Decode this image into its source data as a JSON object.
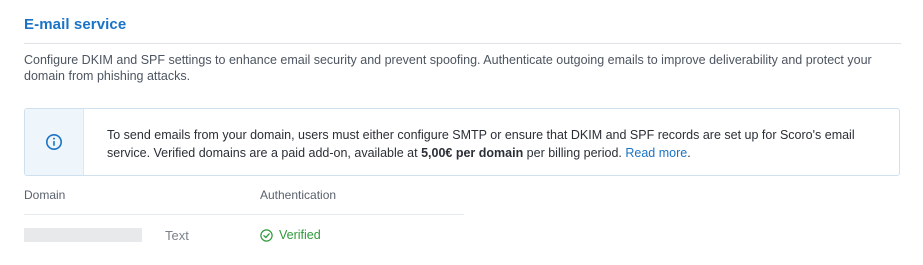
{
  "section": {
    "title": "E-mail service",
    "description": "Configure DKIM and SPF settings to enhance email security and prevent spoofing. Authenticate outgoing emails to improve deliverability and protect your domain from phishing attacks."
  },
  "info": {
    "icon": "info-icon",
    "text_before": "To send emails from your domain, users must either configure SMTP or ensure that DKIM and SPF records are set up for Scoro's email service. Verified domains are a paid add-on, available at ",
    "price": "5,00€ per domain",
    "text_after": " per billing period. ",
    "link_label": "Read more",
    "text_end": "."
  },
  "table": {
    "headers": {
      "domain": "Domain",
      "authentication": "Authentication"
    },
    "rows": [
      {
        "domain": "Text",
        "authentication": "Verified",
        "status_icon": "check-circle-icon"
      }
    ]
  },
  "colors": {
    "accent": "#1a73c6",
    "verified": "#2f9a3a"
  }
}
